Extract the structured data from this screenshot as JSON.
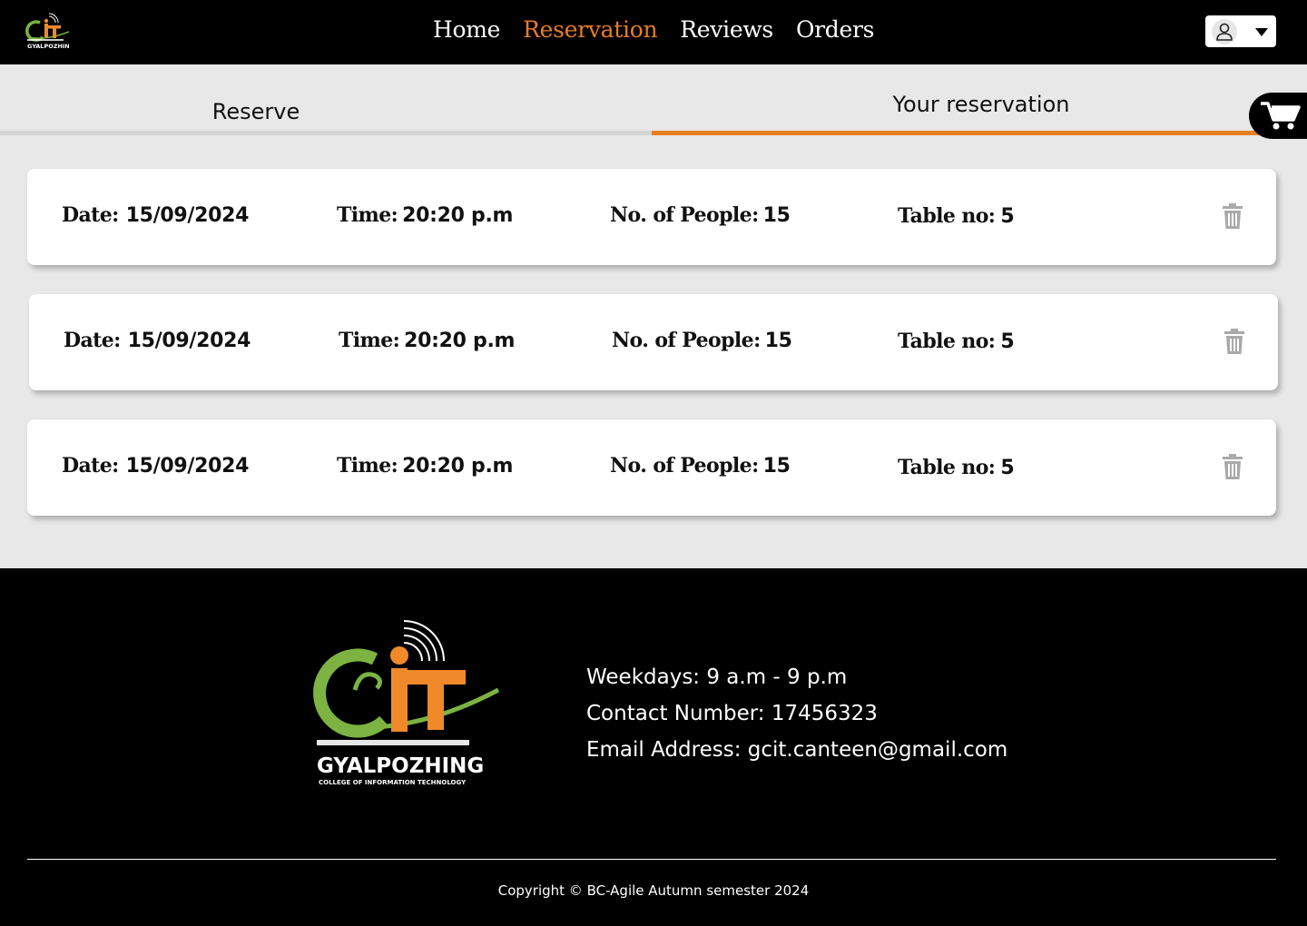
{
  "header": {
    "logo_text": "GYALPOZHING",
    "nav": [
      {
        "label": "Home",
        "active": false
      },
      {
        "label": "Reservation",
        "active": true
      },
      {
        "label": "Reviews",
        "active": false
      },
      {
        "label": "Orders",
        "active": false
      }
    ],
    "user_menu_icon": "user-icon",
    "accent_color": "#e67e22"
  },
  "tabs": {
    "reserve_label": "Reserve",
    "yours_label": "Your reservation",
    "active": "Your reservation"
  },
  "reservations": [
    {
      "date_label": "Date:",
      "date": "15/09/2024",
      "time_label": "Time:",
      "time": "20:20 p.m",
      "people_label": "No. of People:",
      "people": "15",
      "table_label": "Table no:",
      "table": "5"
    },
    {
      "date_label": "Date:",
      "date": "15/09/2024",
      "time_label": "Time:",
      "time": "20:20 p.m",
      "people_label": "No. of People:",
      "people": "15",
      "table_label": "Table no:",
      "table": "5"
    },
    {
      "date_label": "Date:",
      "date": "15/09/2024",
      "time_label": "Time:",
      "time": "20:20 p.m",
      "people_label": "No. of People:",
      "people": "15",
      "table_label": "Table no:",
      "table": "5"
    }
  ],
  "footer": {
    "logo": {
      "name": "GYALPOZHING",
      "subtitle": "COLLEGE OF INFORMATION TECHNOLOGY"
    },
    "hours": "Weekdays: 9 a.m - 9 p.m",
    "contact": "Contact Number: 17456323",
    "email": "Email Address: gcit.canteen@gmail.com",
    "copyright": "Copyright © BC-Agile Autumn semester 2024"
  }
}
